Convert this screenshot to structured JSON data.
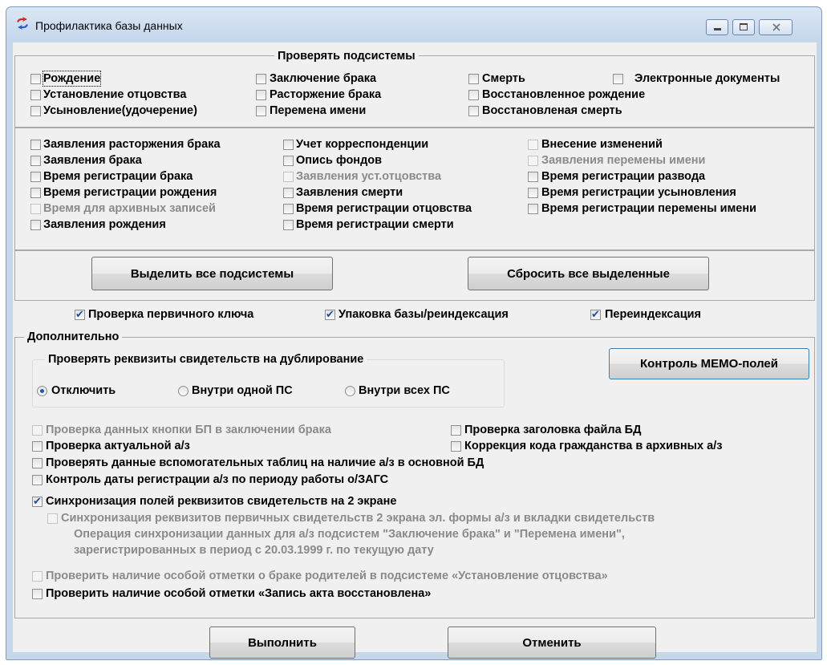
{
  "window": {
    "title": "Профилактика базы данных"
  },
  "subsystems": {
    "legend": "Проверять подсистемы",
    "birth": "Рождение",
    "marriage": "Заключение брака",
    "death": "Смерть",
    "edocs": "Электронные документы",
    "paternity": "Установление отцовства",
    "divorce": "Расторжение брака",
    "restored_birth": "Восстановленное рождение",
    "adoption": "Усыновление(удочерение)",
    "name_change": "Перемена имени",
    "restored_death": "Восстановленая смерть"
  },
  "extra_subsystems": {
    "divorce_applications": "Заявления расторжения брака",
    "correspondence": "Учет корреспонденции",
    "amendments": "Внесение изменений",
    "marriage_applications": "Заявления брака",
    "funds_inventory": "Опись фондов",
    "name_change_applications": "Заявления перемены имени",
    "marriage_time": "Время регистрации брака",
    "paternity_applications": "Заявления уст.отцовства",
    "divorce_time": "Время регистрации развода",
    "birth_time": "Время регистрации рождения",
    "death_applications": "Заявления смерти",
    "adoption_time": "Время регистрации усыновления",
    "archive_time": "Время для архивных записей",
    "paternity_time": "Время регистрации отцовства",
    "name_change_time": "Время регистрации перемены имени",
    "birth_applications": "Заявления рождения",
    "death_time": "Время регистрации смерти"
  },
  "buttons": {
    "select_all": "Выделить все подсистемы",
    "reset_all": "Сбросить все выделенные",
    "memo": "Контроль МЕМО-полей",
    "run": "Выполнить",
    "cancel": "Отменить"
  },
  "options": {
    "primary_key": "Проверка первичного ключа",
    "pack_reindex": "Упаковка базы/реиндексация",
    "reindex": "Переиндексация"
  },
  "additional": {
    "legend": "Дополнительно",
    "dup_group": "Проверять реквизиты свидетельств на дублирование",
    "radio_off": "Отключить",
    "radio_one": "Внутри одной ПС",
    "radio_all": "Внутри всех ПС",
    "bp_button_check": "Проверка данных кнопки БП в заключении брака",
    "file_header": "Проверка заголовка файла БД",
    "actual_record": "Проверка актуальной а/з",
    "citizenship_fix": "Коррекция кода гражданства в архивных а/з",
    "aux_tables": "Проверять данные вспомогательных таблиц на наличие а/з в основной БД",
    "reg_date_control": "Контроль даты регистрации а/з по периоду работы о/ЗАГС",
    "sync_fields": "Синхронизация полей реквизитов свидетельств на 2 экране",
    "sync_primary": "Синхронизация реквизитов первичных свидетельств 2 экрана эл. формы а/з и вкладки свидетельств",
    "sync_note_1": "Операция синхронизации данных для а/з подсистем \"Заключение брака\" и \"Перемена имени\",",
    "sync_note_2": "зарегистрированных в период с 20.03.1999 г. по текущую дату",
    "parents_marriage_mark": "Проверить наличие особой отметки о браке родителей в подсистеме «Установление отцовства»",
    "restored_record_mark": "Проверить наличие особой отметки «Запись акта восстановлена»"
  }
}
